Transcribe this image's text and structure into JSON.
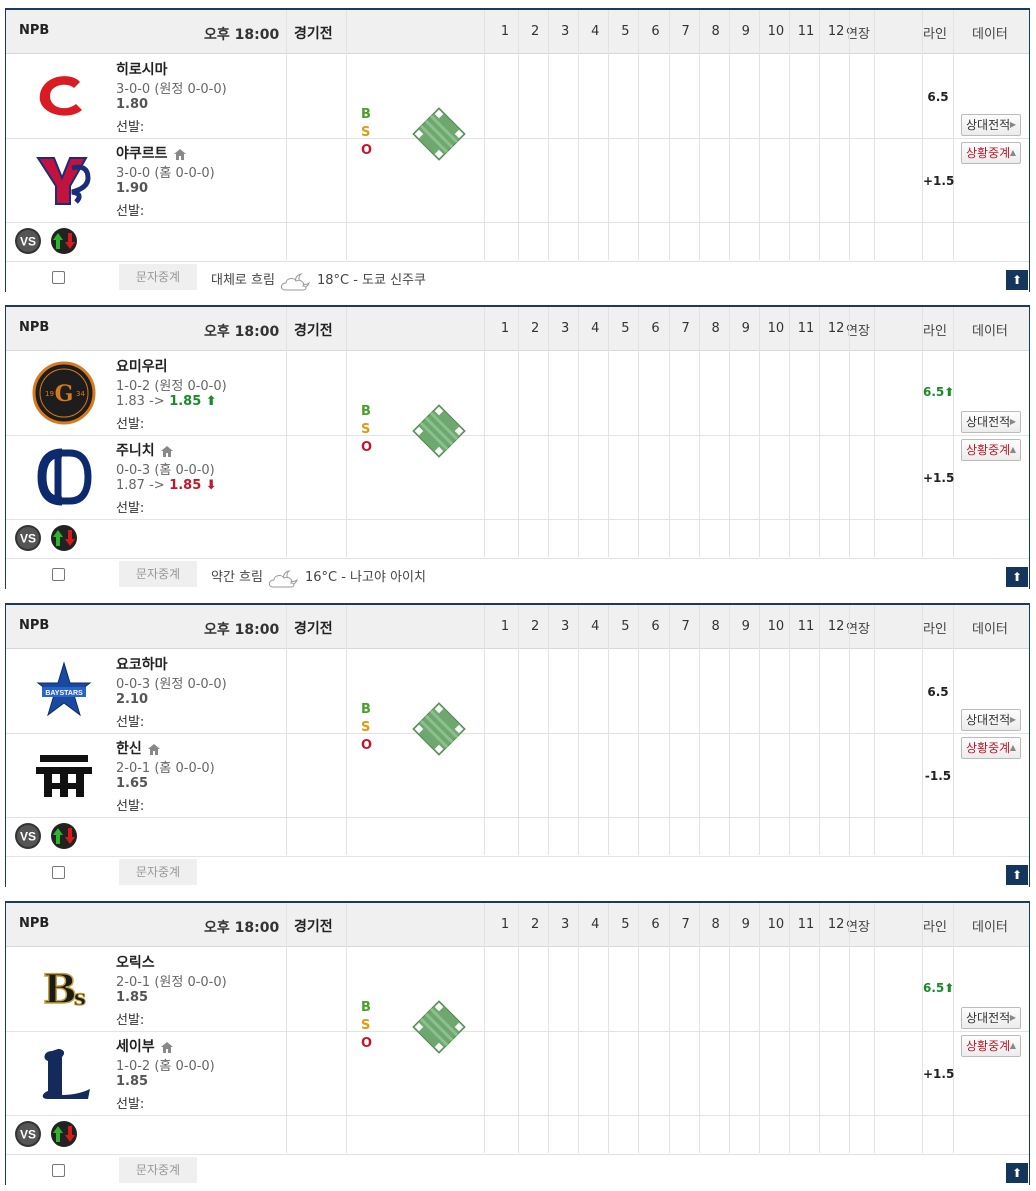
{
  "header": {
    "league": "NPB",
    "time": "오후 18:00",
    "status": "경기전",
    "innings": [
      "1",
      "2",
      "3",
      "4",
      "5",
      "6",
      "7",
      "8",
      "9",
      "10",
      "11",
      "12"
    ],
    "extra": "연장",
    "line": "라인",
    "data": "데이터"
  },
  "bso": {
    "b": "B",
    "s": "S",
    "o": "O"
  },
  "buttons": {
    "h2h": "상대전적",
    "live": "상황중계"
  },
  "footer": {
    "relay": "문자중계",
    "top": "⬆"
  },
  "games": [
    {
      "away": {
        "name": "히로시마",
        "record": "3-0-0 (원정 0-0-0)",
        "odds": "1.80",
        "starter": "선발:",
        "logo": "carp-logo"
      },
      "home": {
        "name": "야쿠르트",
        "record": "3-0-0 (홈 0-0-0)",
        "odds": "1.90",
        "starter": "선발:",
        "logo": "swallows-logo"
      },
      "line_top": "6.5",
      "line_bottom": "+1.5",
      "weather": {
        "desc": "대체로 흐림",
        "info": "18°C - 도쿄 신주쿠",
        "icon": "cloud-moon-icon"
      }
    },
    {
      "away": {
        "name": "요미우리",
        "record": "1-0-2 (원정 0-0-0)",
        "odds_old": "1.83",
        "odds_arrow": "->",
        "odds": "1.85",
        "odds_dir": "up",
        "starter": "선발:",
        "logo": "giants-logo"
      },
      "home": {
        "name": "주니치",
        "record": "0-0-3 (홈 0-0-0)",
        "odds_old": "1.87",
        "odds_arrow": "->",
        "odds": "1.85",
        "odds_dir": "down",
        "starter": "선발:",
        "logo": "dragons-logo"
      },
      "line_top": "6.5",
      "line_top_dir": "up",
      "line_bottom": "+1.5",
      "weather": {
        "desc": "약간 흐림",
        "info": "16°C - 나고야 아이치",
        "icon": "cloud-moon-icon"
      }
    },
    {
      "away": {
        "name": "요코하마",
        "record": "0-0-3 (원정 0-0-0)",
        "odds": "2.10",
        "starter": "선발:",
        "logo": "baystars-logo"
      },
      "home": {
        "name": "한신",
        "record": "2-0-1 (홈 0-0-0)",
        "odds": "1.65",
        "starter": "선발:",
        "logo": "tigers-logo"
      },
      "line_top": "6.5",
      "line_bottom": "-1.5",
      "weather": {
        "desc": "",
        "info": "",
        "icon": ""
      }
    },
    {
      "away": {
        "name": "오릭스",
        "record": "2-0-1 (원정 0-0-0)",
        "odds": "1.85",
        "starter": "선발:",
        "logo": "buffaloes-logo"
      },
      "home": {
        "name": "세이부",
        "record": "1-0-2 (홈 0-0-0)",
        "odds": "1.85",
        "starter": "선발:",
        "logo": "lions-logo"
      },
      "line_top": "6.5",
      "line_top_dir": "up",
      "line_bottom": "+1.5",
      "weather": {
        "desc": "",
        "info": "",
        "icon": ""
      }
    }
  ],
  "colors": {
    "border": "#1c3a5c",
    "header_bg": "#f0f0f0",
    "up": "#1a8a2a",
    "down": "#c0182a",
    "bso_b": "#4aa02c",
    "bso_s": "#e39a12",
    "bso_o": "#c0182a"
  }
}
